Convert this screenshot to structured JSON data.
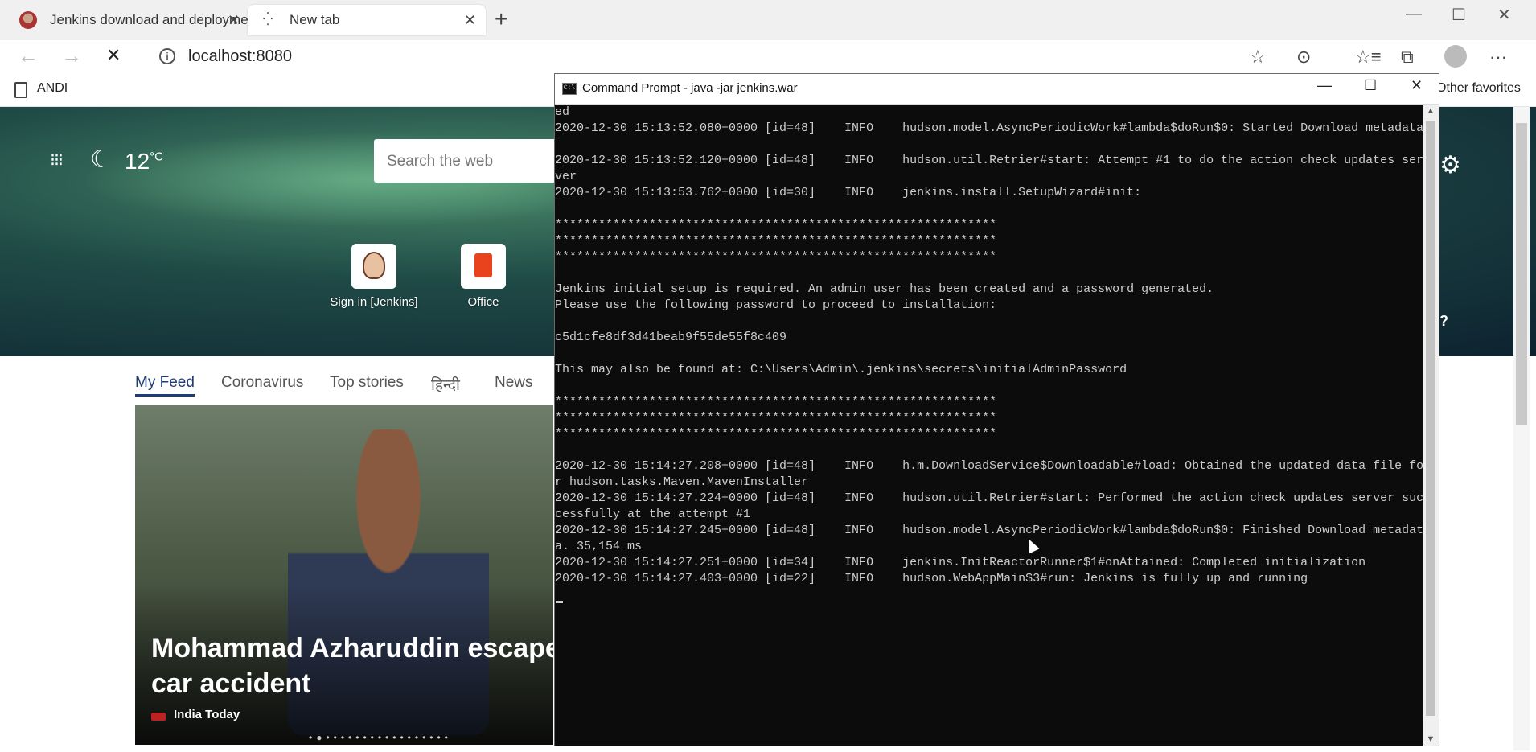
{
  "browser": {
    "tabs": [
      {
        "title": "Jenkins download and deployme",
        "close": "✕"
      },
      {
        "title": "New tab",
        "icon": "⁛",
        "close": "✕"
      }
    ],
    "new_tab": "+",
    "window_controls": {
      "minimize": "—",
      "maximize": "☐",
      "close": "✕"
    },
    "nav": {
      "back": "←",
      "forward": "→",
      "stop": "✕"
    },
    "url": "localhost:8080",
    "info_icon": "i",
    "toolbar": {
      "favorite": "☆",
      "reading": "⊙",
      "favorites": "☆≡",
      "collections": "⧉",
      "more": "···"
    }
  },
  "favorites_bar": {
    "item": "ANDI",
    "other": "Other favorites"
  },
  "new_tab_page": {
    "apps": "⁝⁝⁝",
    "moon": "☾",
    "temperature": "12",
    "temp_unit": "°C",
    "search_placeholder": "Search the web",
    "tiles": [
      {
        "label": "Sign in [Jenkins]"
      },
      {
        "label": "Office"
      }
    ],
    "gear": "⚙",
    "help": "?",
    "feed_tabs": [
      "My Feed",
      "Coronavirus",
      "Top stories",
      "हिन्दी",
      "News"
    ],
    "headline": "Mohammad Azharuddin escape car accident",
    "source": "India Today",
    "carousel_dots": "•●•••••••••••••••••"
  },
  "cmd": {
    "title": "Command Prompt - java  -jar jenkins.war",
    "icon_label": "C:\\",
    "buttons": {
      "minimize": "—",
      "maximize": "☐",
      "close": "✕"
    },
    "scroll_up": "▲",
    "scroll_down": "▼",
    "lines": [
      "ed",
      "2020-12-30 15:13:52.080+0000 [id=48]    INFO    hudson.model.AsyncPeriodicWork#lambda$doRun$0: Started Download metadata",
      "",
      "2020-12-30 15:13:52.120+0000 [id=48]    INFO    hudson.util.Retrier#start: Attempt #1 to do the action check updates ser",
      "ver",
      "2020-12-30 15:13:53.762+0000 [id=30]    INFO    jenkins.install.SetupWizard#init:",
      "",
      "*************************************************************",
      "*************************************************************",
      "*************************************************************",
      "",
      "Jenkins initial setup is required. An admin user has been created and a password generated.",
      "Please use the following password to proceed to installation:",
      "",
      "c5d1cfe8df3d41beab9f55de55f8c409",
      "",
      "This may also be found at: C:\\Users\\Admin\\.jenkins\\secrets\\initialAdminPassword",
      "",
      "*************************************************************",
      "*************************************************************",
      "*************************************************************",
      "",
      "2020-12-30 15:14:27.208+0000 [id=48]    INFO    h.m.DownloadService$Downloadable#load: Obtained the updated data file fo",
      "r hudson.tasks.Maven.MavenInstaller",
      "2020-12-30 15:14:27.224+0000 [id=48]    INFO    hudson.util.Retrier#start: Performed the action check updates server suc",
      "cessfully at the attempt #1",
      "2020-12-30 15:14:27.245+0000 [id=48]    INFO    hudson.model.AsyncPeriodicWork#lambda$doRun$0: Finished Download metadat",
      "a. 35,154 ms",
      "2020-12-30 15:14:27.251+0000 [id=34]    INFO    jenkins.InitReactorRunner$1#onAttained: Completed initialization",
      "2020-12-30 15:14:27.403+0000 [id=22]    INFO    hudson.WebAppMain$3#run: Jenkins is fully up and running"
    ]
  }
}
